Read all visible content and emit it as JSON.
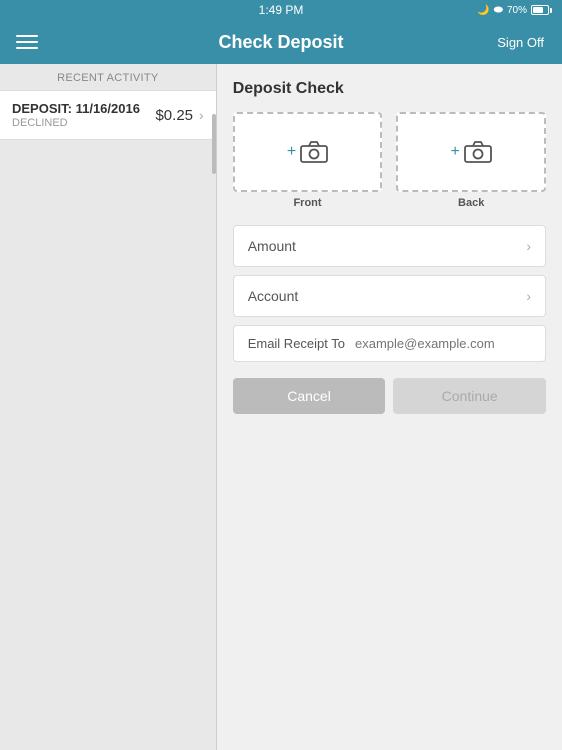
{
  "statusBar": {
    "time": "1:49 PM",
    "batteryPercent": "70%",
    "bluetoothIcon": "bluetooth",
    "moonIcon": "moon"
  },
  "header": {
    "title": "Check Deposit",
    "menuIcon": "hamburger-menu",
    "signOffLabel": "Sign Off"
  },
  "leftPanel": {
    "recentActivityLabel": "RECENT ACTIVITY",
    "depositItem": {
      "prefix": "DEPOSIT:",
      "date": "11/16/2016",
      "amount": "$0.25",
      "status": "DECLINED"
    }
  },
  "rightPanel": {
    "title": "Deposit Check",
    "frontLabel": "Front",
    "backLabel": "Back",
    "cameraPlus": "+ ",
    "amountLabel": "Amount",
    "accountLabel": "Account",
    "emailLabel": "Email Receipt To",
    "emailPlaceholder": "example@example.com",
    "cancelLabel": "Cancel",
    "continueLabel": "Continue"
  }
}
